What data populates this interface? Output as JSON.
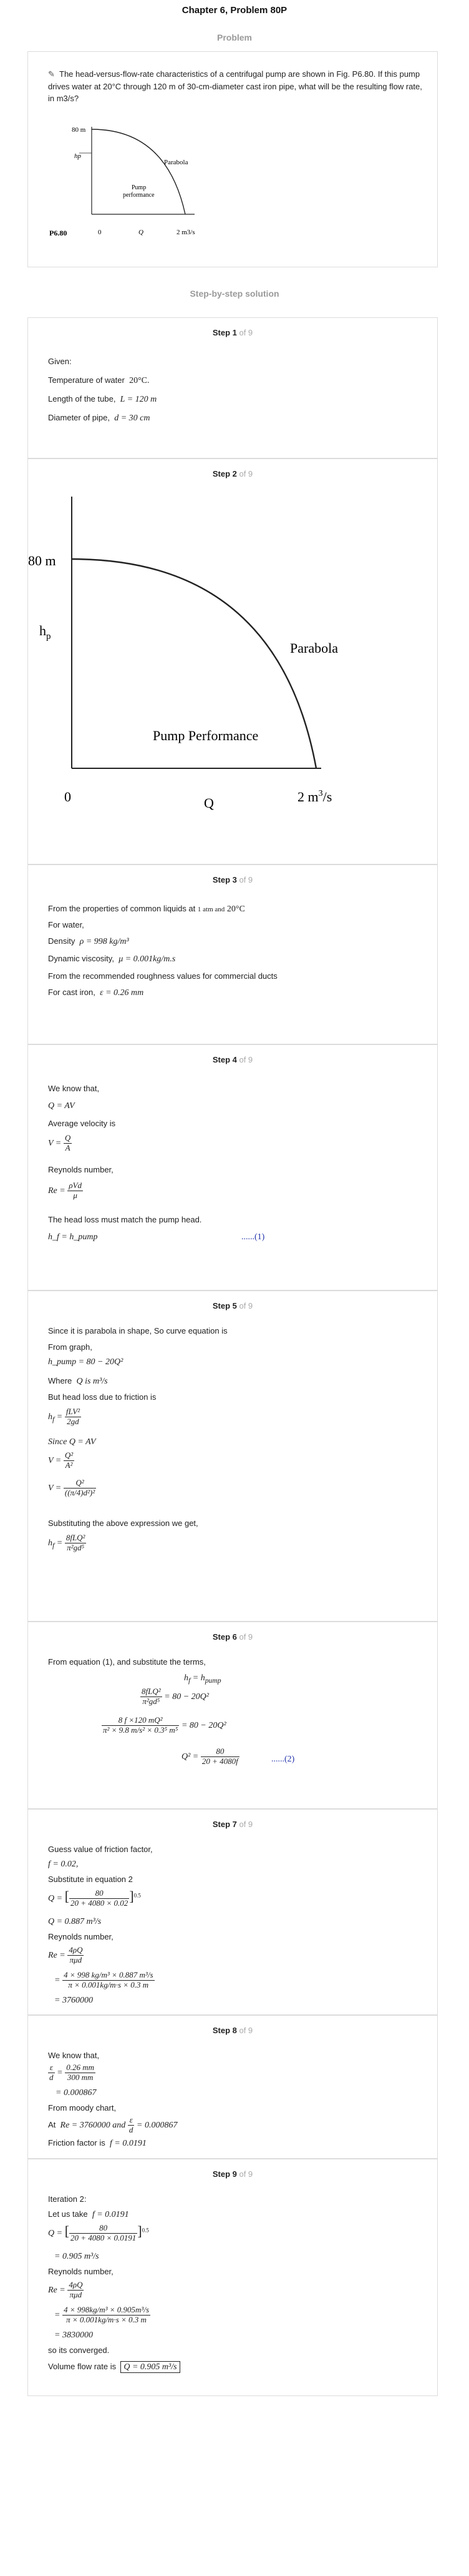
{
  "header": {
    "title": "Chapter 6, Problem 80P",
    "problem_label": "Problem",
    "solution_label": "Step-by-step solution"
  },
  "problem": {
    "text": "The head-versus-flow-rate characteristics of a centrifugal pump are shown in Fig. P6.80. If this pump drives water at 20°C through 120 m of 30-cm-diameter cast iron pipe, what will be the resulting flow rate, in m3/s?",
    "figure": {
      "y_top": "80 m",
      "y_label": "hp",
      "curve_label": "Parabola",
      "inner_label_1": "Pump",
      "inner_label_2": "performance",
      "fig_id": "P6.80",
      "x_zero": "0",
      "x_mid": "Q",
      "x_end": "2 m3/s"
    }
  },
  "steps": [
    {
      "label": "Step 1",
      "of": " of 9"
    },
    {
      "label": "Step 2",
      "of": " of 9"
    },
    {
      "label": "Step 3",
      "of": " of 9"
    },
    {
      "label": "Step 4",
      "of": " of 9"
    },
    {
      "label": "Step 5",
      "of": " of 9"
    },
    {
      "label": "Step 6",
      "of": " of 9"
    },
    {
      "label": "Step 7",
      "of": " of 9"
    },
    {
      "label": "Step 8",
      "of": " of 9"
    },
    {
      "label": "Step 9",
      "of": " of 9"
    }
  ],
  "step1": {
    "given": "Given:",
    "temp": "Temperature of water",
    "temp_v": "20°C.",
    "len": "Length of the tube,",
    "len_v": "L = 120 m",
    "dia": "Diameter of pipe,",
    "dia_v": "d = 30 cm"
  },
  "step2": {
    "y_top": "80 m",
    "y_label": "h",
    "y_sub": "p",
    "curve": "Parabola",
    "inner": "Pump Performance",
    "x_zero": "0",
    "x_mid": "Q",
    "x_end": "2 m",
    "x_end_sup": "3",
    "x_end_tail": "/s"
  },
  "step3": {
    "l1a": "From the properties of common liquids at",
    "l1b": "1 atm and",
    "l1c": "20°C",
    "l2": "For water,",
    "l3": "Density",
    "l3v": "ρ = 998 kg/m³",
    "l4": "Dynamic viscosity,",
    "l4v": "μ = 0.001kg/m.s",
    "l5": "From the recommended roughness values for commercial ducts",
    "l6": "For cast iron,",
    "l6v": "ε = 0.26 mm"
  },
  "step4": {
    "l1": "We know that,",
    "l2": "Q = AV",
    "l3": "Average velocity is",
    "l4a": "V =",
    "l5": "Reynolds number,",
    "l6a": "Re =",
    "l7": "The head loss must match the pump head.",
    "l8": "h_f = h_pump",
    "ref": "......(1)"
  },
  "step5": {
    "l1": "Since it is parabola in shape, So curve equation is",
    "l2": "From graph,",
    "l3": "h_pump = 80 − 20Q²",
    "l4a": "Where",
    "l4b": "Q is m³/s",
    "l5": "But head loss due to friction is",
    "l7": "Since Q = AV",
    "l10": "Substituting the above expression we get,"
  },
  "step6": {
    "l1": "From equation (1), and substitute the terms,",
    "ref": "......(2)"
  },
  "step7": {
    "l1": "Guess value of friction factor,",
    "l2": "f = 0.02,",
    "l3": "Substitute in equation 2",
    "l5": "Q = 0.887 m³/s",
    "l6": "Reynolds number,",
    "l9": "= 3760000"
  },
  "step8": {
    "l1": "We know that,",
    "l3": "= 0.000867",
    "l4": "From moody chart,",
    "l5a": "At",
    "l5b": "Re = 3760000 and",
    "l5c": "= 0.000867",
    "l6a": "Friction factor is",
    "l6b": "f = 0.0191"
  },
  "step9": {
    "l1": "Iteration 2:",
    "l2a": "Let us take",
    "l2b": "f = 0.0191",
    "l4": "= 0.905 m³/s",
    "l5": "Reynolds number,",
    "l8": "= 3830000",
    "l9": "so its converged.",
    "l10a": "Volume flow rate is",
    "l10b": "Q = 0.905 m³/s"
  }
}
